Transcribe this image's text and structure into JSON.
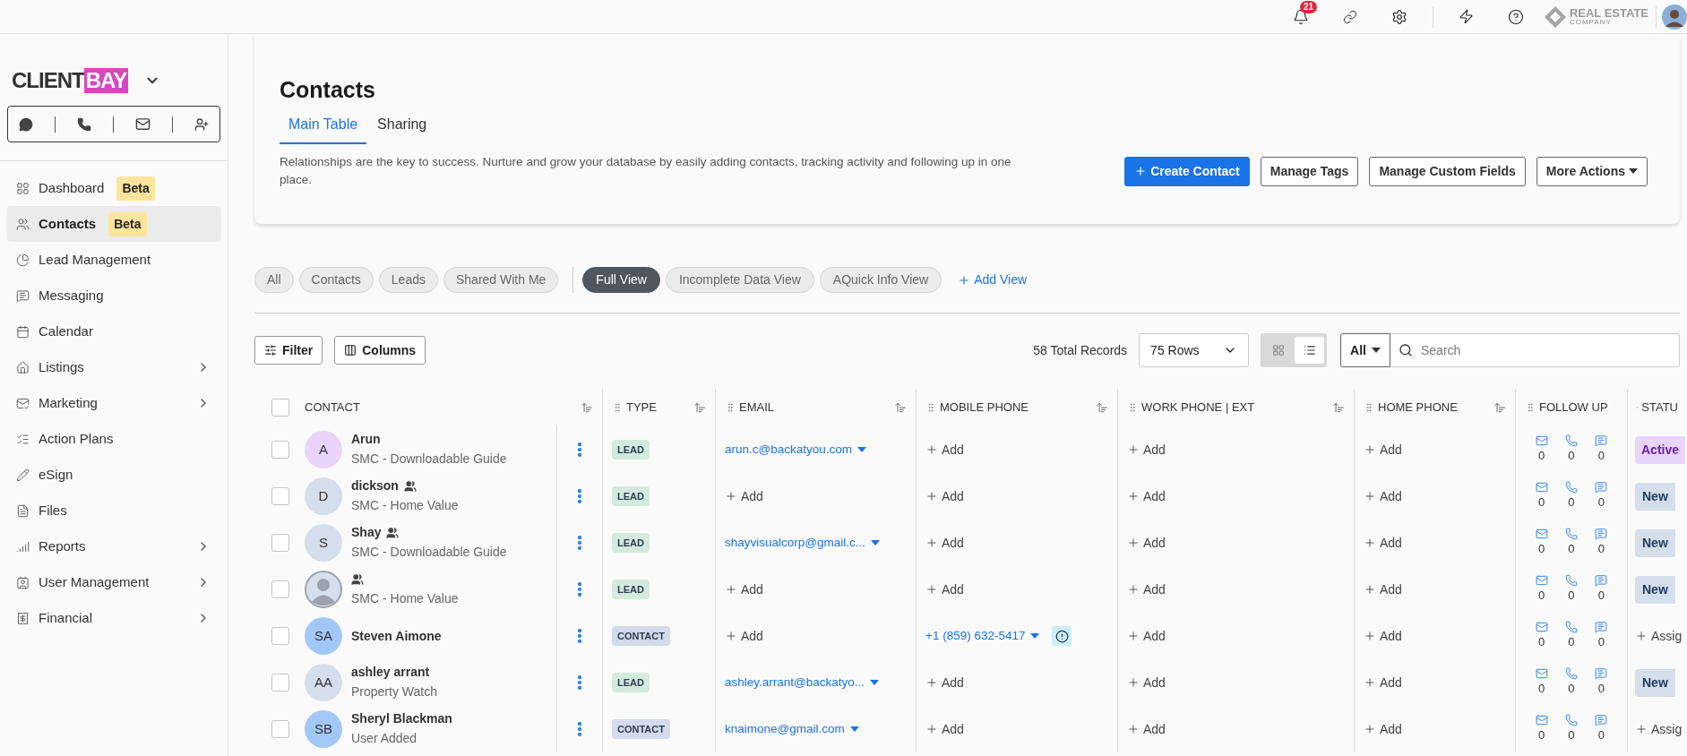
{
  "top_bar": {
    "notification_count": "21",
    "logo": {
      "line_1": "REAL ESTATE",
      "line_2": "COMPANY"
    }
  },
  "sidebar": {
    "brand": {
      "left": "CLIENT",
      "right": "BAY"
    },
    "items": [
      {
        "label": "Dashboard",
        "badge": "Beta",
        "selected": false,
        "expandable": false
      },
      {
        "label": "Contacts",
        "badge": "Beta",
        "selected": true,
        "expandable": false
      },
      {
        "label": "Lead Management",
        "selected": false,
        "expandable": false
      },
      {
        "label": "Messaging",
        "selected": false,
        "expandable": false
      },
      {
        "label": "Calendar",
        "selected": false,
        "expandable": false
      },
      {
        "label": "Listings",
        "selected": false,
        "expandable": true
      },
      {
        "label": "Marketing",
        "selected": false,
        "expandable": true
      },
      {
        "label": "Action Plans",
        "selected": false,
        "expandable": false
      },
      {
        "label": "eSign",
        "selected": false,
        "expandable": false
      },
      {
        "label": "Files",
        "selected": false,
        "expandable": false
      },
      {
        "label": "Reports",
        "selected": false,
        "expandable": true
      },
      {
        "label": "User Management",
        "selected": false,
        "expandable": true
      },
      {
        "label": "Financial",
        "selected": false,
        "expandable": true
      }
    ]
  },
  "page": {
    "title": "Contacts",
    "tabs": [
      {
        "label": "Main Table",
        "selected": true
      },
      {
        "label": "Sharing",
        "selected": false
      }
    ],
    "description": "Relationships are the key to success. Nurture and grow your database by easily adding contacts, tracking activity and following up in one place.",
    "actions": [
      {
        "label": "Create Contact",
        "kind": "primary"
      },
      {
        "label": "Manage Tags",
        "kind": "outline"
      },
      {
        "label": "Manage Custom Fields",
        "kind": "outline"
      },
      {
        "label": "More Actions",
        "kind": "dropdown"
      }
    ]
  },
  "filters": [
    {
      "label": "All",
      "selected": false
    },
    {
      "label": "Contacts",
      "selected": false
    },
    {
      "label": "Leads",
      "selected": false
    },
    {
      "label": "Shared With Me",
      "selected": false
    }
  ],
  "views": [
    {
      "label": "Full View",
      "selected": true
    },
    {
      "label": "Incomplete Data View",
      "selected": false
    },
    {
      "label": "AQuick Info View",
      "selected": false
    }
  ],
  "add_view": "Add View",
  "toolbar": {
    "filter": "Filter",
    "columns": "Columns",
    "total": "58 Total Records",
    "rows": "75 Rows",
    "layouts": [
      {
        "kind": "grid",
        "selected": false
      },
      {
        "kind": "list",
        "selected": true
      }
    ],
    "scope": "All",
    "search_placeholder": "Search"
  },
  "table": {
    "select_all_checked": false,
    "columns": [
      {
        "label": "CONTACT",
        "draggable": false,
        "sortable": true
      },
      {
        "label": "TYPE",
        "draggable": true,
        "sortable": true
      },
      {
        "label": "EMAIL",
        "draggable": true,
        "sortable": true
      },
      {
        "label": "MOBILE PHONE",
        "draggable": true,
        "sortable": true
      },
      {
        "label": "WORK PHONE | EXT",
        "draggable": true,
        "sortable": true
      },
      {
        "label": "HOME PHONE",
        "draggable": true,
        "sortable": true
      },
      {
        "label": "FOLLOW UP",
        "draggable": true,
        "sortable": false
      },
      {
        "label": "STATU",
        "draggable": true,
        "sortable": false
      }
    ],
    "rows": [
      {
        "checked": false,
        "avatar": {
          "kind": "initials",
          "text": "A",
          "color": "#e9d5fb"
        },
        "name": "Arun",
        "shared": false,
        "subtitle": "SMC - Downloadable Guide",
        "type": {
          "kind": "lead",
          "text": "LEAD"
        },
        "email": {
          "kind": "value",
          "text": "arun.c@backatyou.com"
        },
        "mobile": {
          "kind": "add",
          "text": "Add",
          "warning": false
        },
        "work": "Add",
        "home": "Add",
        "follow_up": {
          "emails": "0",
          "calls": "0",
          "messages": "0"
        },
        "status": {
          "kind": "active",
          "text": "Active"
        }
      },
      {
        "checked": false,
        "avatar": {
          "kind": "initials",
          "text": "D",
          "color": "#d5deeb"
        },
        "name": "dickson",
        "shared": true,
        "subtitle": "SMC - Home Value",
        "type": {
          "kind": "lead",
          "text": "LEAD"
        },
        "email": {
          "kind": "add",
          "text": "Add"
        },
        "mobile": {
          "kind": "add",
          "text": "Add",
          "warning": false
        },
        "work": "Add",
        "home": "Add",
        "follow_up": {
          "emails": "0",
          "calls": "0",
          "messages": "0"
        },
        "status": {
          "kind": "new",
          "text": "New"
        }
      },
      {
        "checked": false,
        "avatar": {
          "kind": "initials",
          "text": "S",
          "color": "#d5deeb"
        },
        "name": "Shay",
        "shared": true,
        "subtitle": "SMC - Downloadable Guide",
        "type": {
          "kind": "lead",
          "text": "LEAD"
        },
        "email": {
          "kind": "value",
          "text": "shayvisualcorp@gmail.c..."
        },
        "mobile": {
          "kind": "add",
          "text": "Add",
          "warning": false
        },
        "work": "Add",
        "home": "Add",
        "follow_up": {
          "emails": "0",
          "calls": "0",
          "messages": "0"
        },
        "status": {
          "kind": "new",
          "text": "New"
        }
      },
      {
        "checked": false,
        "avatar": {
          "kind": "placeholder",
          "color": "#d5deeb"
        },
        "shared": true,
        "subtitle": "SMC - Home Value",
        "type": {
          "kind": "lead",
          "text": "LEAD"
        },
        "email": {
          "kind": "add",
          "text": "Add"
        },
        "mobile": {
          "kind": "add",
          "text": "Add",
          "warning": false
        },
        "work": "Add",
        "home": "Add",
        "follow_up": {
          "emails": "0",
          "calls": "0",
          "messages": "0"
        },
        "status": {
          "kind": "new",
          "text": "New"
        }
      },
      {
        "checked": false,
        "avatar": {
          "kind": "initials",
          "text": "SA",
          "color": "#a3c8f8"
        },
        "name": "Steven Aimone",
        "shared": false,
        "type": {
          "kind": "contact",
          "text": "CONTACT"
        },
        "email": {
          "kind": "add",
          "text": "Add"
        },
        "mobile": {
          "kind": "value",
          "text": "+1 (859) 632-5417",
          "warning": true
        },
        "work": "Add",
        "home": "Add",
        "follow_up": {
          "emails": "0",
          "calls": "0",
          "messages": "0"
        },
        "status": {
          "kind": "assign",
          "text": "Assig"
        }
      },
      {
        "checked": false,
        "avatar": {
          "kind": "initials",
          "text": "AA",
          "color": "#d5deeb"
        },
        "name": "ashley arrant",
        "shared": false,
        "subtitle": "Property Watch",
        "type": {
          "kind": "lead",
          "text": "LEAD"
        },
        "email": {
          "kind": "value",
          "text": "ashley.arrant@backatyo..."
        },
        "mobile": {
          "kind": "add",
          "text": "Add",
          "warning": false
        },
        "work": "Add",
        "home": "Add",
        "follow_up": {
          "emails": "0",
          "calls": "0",
          "messages": "0"
        },
        "status": {
          "kind": "new",
          "text": "New"
        }
      },
      {
        "checked": false,
        "avatar": {
          "kind": "initials",
          "text": "SB",
          "color": "#a3c8f8"
        },
        "name": "Sheryl Blackman",
        "shared": false,
        "subtitle": "User Added",
        "type": {
          "kind": "contact",
          "text": "CONTACT"
        },
        "email": {
          "kind": "value",
          "text": "knaimone@gmail.com"
        },
        "mobile": {
          "kind": "add",
          "text": "Add",
          "warning": false
        },
        "work": "Add",
        "home": "Add",
        "follow_up": {
          "emails": "0",
          "calls": "0",
          "messages": "0"
        },
        "status": {
          "kind": "assign",
          "text": "Assig"
        }
      }
    ]
  }
}
